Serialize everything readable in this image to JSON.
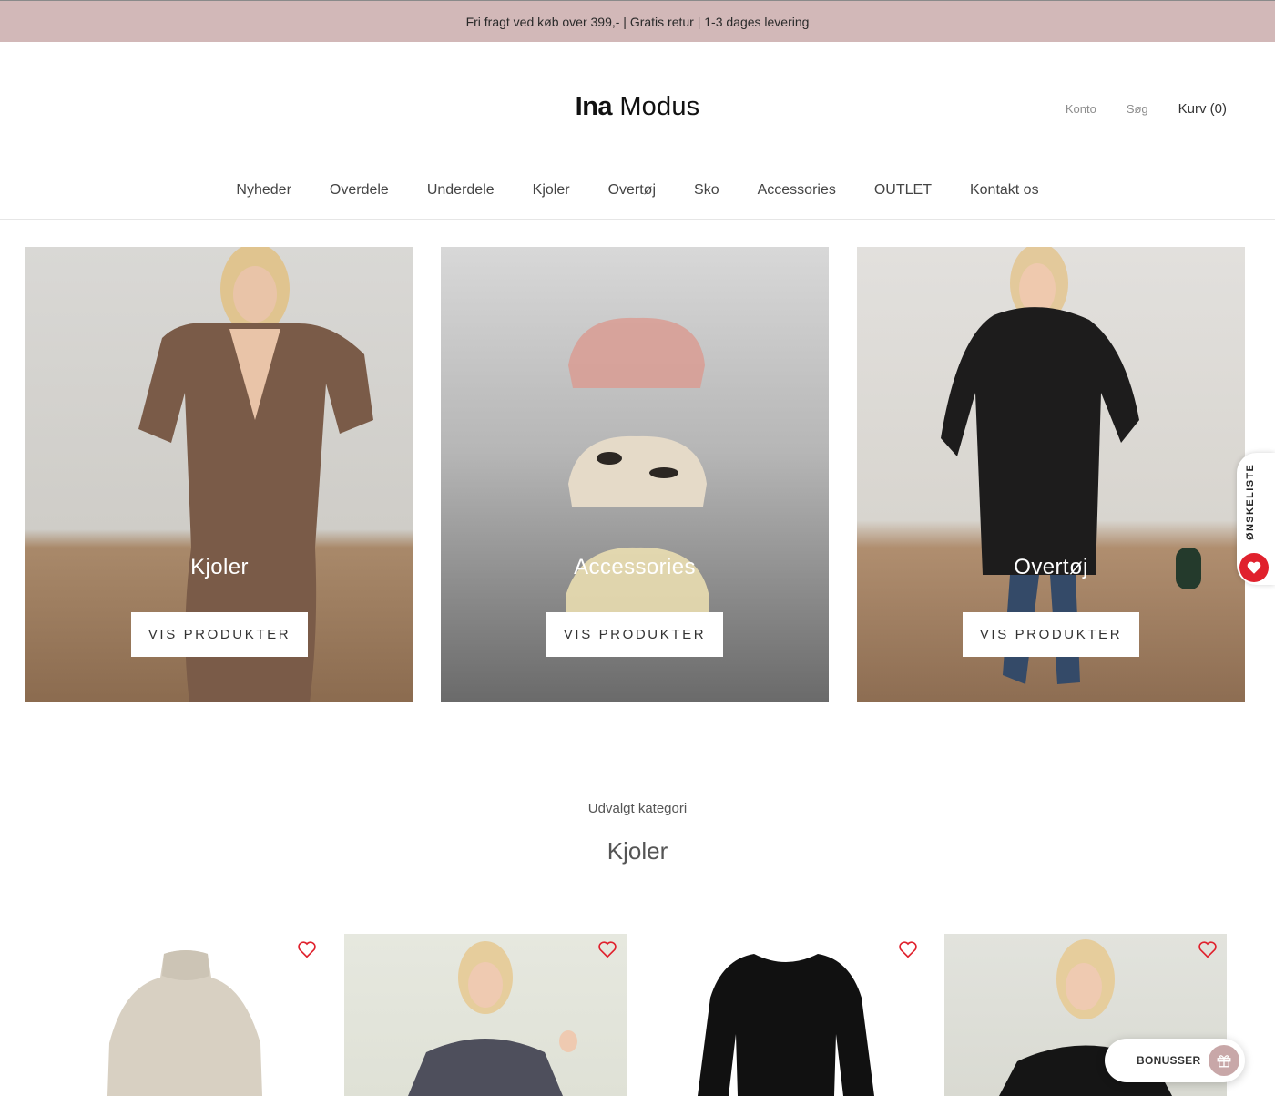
{
  "announcement": "Fri fragt ved køb over 399,- | Gratis retur | 1-3 dages levering",
  "brand": {
    "part1": "Ina",
    "part2": "Modus"
  },
  "header": {
    "account": "Konto",
    "search": "Søg",
    "cart": "Kurv (0)"
  },
  "nav": [
    "Nyheder",
    "Overdele",
    "Underdele",
    "Kjoler",
    "Overtøj",
    "Sko",
    "Accessories",
    "OUTLET",
    "Kontakt os"
  ],
  "tiles": [
    {
      "title": "Kjoler",
      "button": "VIS PRODUKTER"
    },
    {
      "title": "Accessories",
      "button": "VIS PRODUKTER"
    },
    {
      "title": "Overtøj",
      "button": "VIS PRODUKTER"
    }
  ],
  "featured": {
    "label": "Udvalgt kategori",
    "title": "Kjoler"
  },
  "wishlist": {
    "label": "ØNSKELISTE"
  },
  "bonus": {
    "label": "BONUSSER"
  },
  "colors": {
    "announce_bg": "#d2b8b8",
    "heart": "#e0212d",
    "bonus_accent": "#c8a7a8"
  }
}
